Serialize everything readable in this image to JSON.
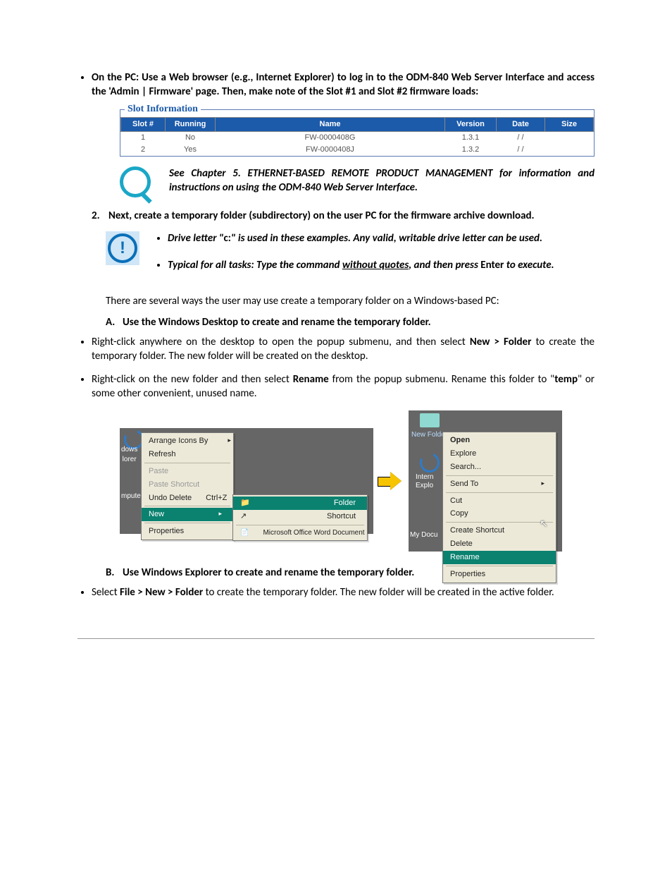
{
  "bullet_intro": {
    "prefix": "On the PC: Use a Web browser (e.g., Internet Explorer) to log in to the ODM-840 Web Server Interface and access the 'Admin | Firmware' page. Then, make note of the Slot #1 and Slot #2 firmware loads:"
  },
  "slot_info": {
    "title": "Slot Information",
    "headers": [
      "Slot #",
      "Running",
      "Name",
      "Version",
      "Date",
      "Size"
    ],
    "rows": [
      {
        "slot": "1",
        "running": "No",
        "name": "FW-0000408G",
        "version": "1.3.1",
        "date": "/ /",
        "size": ""
      },
      {
        "slot": "2",
        "running": "Yes",
        "name": "FW-0000408J",
        "version": "1.3.2",
        "date": "/ /",
        "size": ""
      }
    ]
  },
  "see_note": {
    "lead": "See ",
    "body": "Chapter 5. ETHERNET-BASED REMOTE PRODUCT MANAGEMENT for information and instructions on using the ODM-840 Web Server Interface."
  },
  "step2": {
    "num": "2.",
    "text": "Next, create a temporary folder (subdirectory) on the user PC for the firmware archive download."
  },
  "caution": {
    "b1_pre": "Drive letter \"",
    "b1_c": "c:",
    "b1_post": "\" is used in these examples. Any valid, writable drive letter can be used.",
    "b2_pre": "Typical for all tasks: Type the command ",
    "b2_u": "without quotes",
    "b2_mid": ", and then press ",
    "b2_enter": "Enter",
    "b2_post": " to execute."
  },
  "para_ways": "There are several ways the user may use create a temporary folder on a Windows-based PC:",
  "A": {
    "ltr": "A.",
    "title": "Use the Windows Desktop to create and rename the temporary folder.",
    "b1_pre": "Right-click anywhere on the desktop to open the popup submenu, and then select ",
    "b1_bold": "New > Folder",
    "b1_post": " to create the temporary folder. The new folder will be created on the desktop.",
    "b2_pre": "Right-click on the new folder and then select ",
    "b2_bold1": "Rename",
    "b2_mid": " from the popup submenu. Rename this folder to \"",
    "b2_bold2": "temp",
    "b2_post": "\" or some other convenient, unused name."
  },
  "menu_left": {
    "arrange": "Arrange Icons By",
    "refresh": "Refresh",
    "paste": "Paste",
    "paste_shortcut": "Paste Shortcut",
    "undo": "Undo Delete",
    "undo_key": "Ctrl+Z",
    "new": "New",
    "properties": "Properties",
    "sub_folder": "Folder",
    "sub_shortcut": "Shortcut",
    "sub_word": "Microsoft Office Word Document"
  },
  "menu_right": {
    "new_folder": "New Folder",
    "open": "Open",
    "explore": "Explore",
    "search": "Search...",
    "sendto": "Send To",
    "cut": "Cut",
    "copy": "Copy",
    "create_shortcut": "Create Shortcut",
    "delete": "Delete",
    "rename": "Rename",
    "properties": "Properties",
    "intern": "Intern",
    "explo_lbl": "Explo",
    "mydocu": "My Docu"
  },
  "B": {
    "ltr": "B.",
    "title": "Use Windows Explorer to create and rename the temporary folder.",
    "b1_pre": "Select ",
    "b1_bold": "File > New > Folder",
    "b1_post": " to create the temporary folder. The new folder will be created in the active folder."
  }
}
